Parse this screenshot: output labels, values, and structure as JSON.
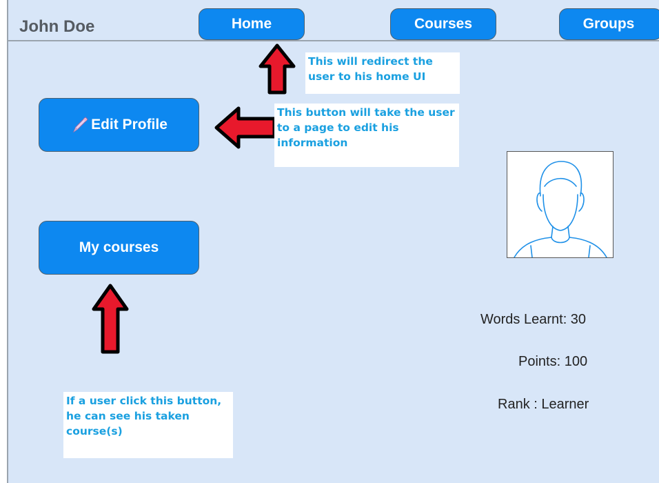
{
  "header": {
    "user_name": "John Doe",
    "nav": {
      "home": "Home",
      "courses": "Courses",
      "groups": "Groups"
    }
  },
  "buttons": {
    "edit_profile": "Edit Profile",
    "my_courses": "My courses"
  },
  "annotations": {
    "home_note": "This will redirect the user to his home UI",
    "edit_note": "This button will take the user to a page to edit his information",
    "courses_note": "If a user click this button, he can see his taken course(s)"
  },
  "stats": {
    "words_learnt": "Words Learnt: 30",
    "points": "Points: 100",
    "rank": "Rank : Learner"
  },
  "colors": {
    "background": "#d8e6f8",
    "button": "#0d88f0",
    "arrow": "#e8192c",
    "note_text": "#1aa0e0"
  },
  "icons": {
    "edit": "pencil-icon",
    "avatar": "user-avatar-icon",
    "arrows": "red-arrow-icon"
  }
}
